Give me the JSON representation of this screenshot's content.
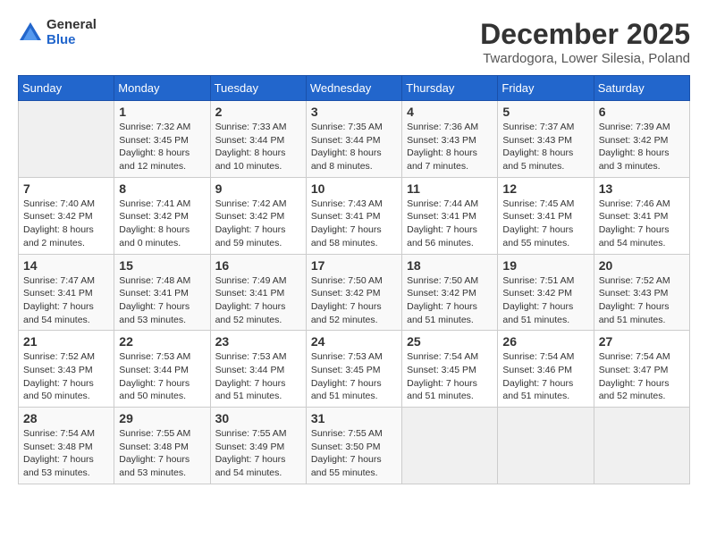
{
  "logo": {
    "general": "General",
    "blue": "Blue"
  },
  "title": "December 2025",
  "location": "Twardogora, Lower Silesia, Poland",
  "days_of_week": [
    "Sunday",
    "Monday",
    "Tuesday",
    "Wednesday",
    "Thursday",
    "Friday",
    "Saturday"
  ],
  "weeks": [
    [
      {
        "day": "",
        "info": ""
      },
      {
        "day": "1",
        "info": "Sunrise: 7:32 AM\nSunset: 3:45 PM\nDaylight: 8 hours\nand 12 minutes."
      },
      {
        "day": "2",
        "info": "Sunrise: 7:33 AM\nSunset: 3:44 PM\nDaylight: 8 hours\nand 10 minutes."
      },
      {
        "day": "3",
        "info": "Sunrise: 7:35 AM\nSunset: 3:44 PM\nDaylight: 8 hours\nand 8 minutes."
      },
      {
        "day": "4",
        "info": "Sunrise: 7:36 AM\nSunset: 3:43 PM\nDaylight: 8 hours\nand 7 minutes."
      },
      {
        "day": "5",
        "info": "Sunrise: 7:37 AM\nSunset: 3:43 PM\nDaylight: 8 hours\nand 5 minutes."
      },
      {
        "day": "6",
        "info": "Sunrise: 7:39 AM\nSunset: 3:42 PM\nDaylight: 8 hours\nand 3 minutes."
      }
    ],
    [
      {
        "day": "7",
        "info": "Sunrise: 7:40 AM\nSunset: 3:42 PM\nDaylight: 8 hours\nand 2 minutes."
      },
      {
        "day": "8",
        "info": "Sunrise: 7:41 AM\nSunset: 3:42 PM\nDaylight: 8 hours\nand 0 minutes."
      },
      {
        "day": "9",
        "info": "Sunrise: 7:42 AM\nSunset: 3:42 PM\nDaylight: 7 hours\nand 59 minutes."
      },
      {
        "day": "10",
        "info": "Sunrise: 7:43 AM\nSunset: 3:41 PM\nDaylight: 7 hours\nand 58 minutes."
      },
      {
        "day": "11",
        "info": "Sunrise: 7:44 AM\nSunset: 3:41 PM\nDaylight: 7 hours\nand 56 minutes."
      },
      {
        "day": "12",
        "info": "Sunrise: 7:45 AM\nSunset: 3:41 PM\nDaylight: 7 hours\nand 55 minutes."
      },
      {
        "day": "13",
        "info": "Sunrise: 7:46 AM\nSunset: 3:41 PM\nDaylight: 7 hours\nand 54 minutes."
      }
    ],
    [
      {
        "day": "14",
        "info": "Sunrise: 7:47 AM\nSunset: 3:41 PM\nDaylight: 7 hours\nand 54 minutes."
      },
      {
        "day": "15",
        "info": "Sunrise: 7:48 AM\nSunset: 3:41 PM\nDaylight: 7 hours\nand 53 minutes."
      },
      {
        "day": "16",
        "info": "Sunrise: 7:49 AM\nSunset: 3:41 PM\nDaylight: 7 hours\nand 52 minutes."
      },
      {
        "day": "17",
        "info": "Sunrise: 7:50 AM\nSunset: 3:42 PM\nDaylight: 7 hours\nand 52 minutes."
      },
      {
        "day": "18",
        "info": "Sunrise: 7:50 AM\nSunset: 3:42 PM\nDaylight: 7 hours\nand 51 minutes."
      },
      {
        "day": "19",
        "info": "Sunrise: 7:51 AM\nSunset: 3:42 PM\nDaylight: 7 hours\nand 51 minutes."
      },
      {
        "day": "20",
        "info": "Sunrise: 7:52 AM\nSunset: 3:43 PM\nDaylight: 7 hours\nand 51 minutes."
      }
    ],
    [
      {
        "day": "21",
        "info": "Sunrise: 7:52 AM\nSunset: 3:43 PM\nDaylight: 7 hours\nand 50 minutes."
      },
      {
        "day": "22",
        "info": "Sunrise: 7:53 AM\nSunset: 3:44 PM\nDaylight: 7 hours\nand 50 minutes."
      },
      {
        "day": "23",
        "info": "Sunrise: 7:53 AM\nSunset: 3:44 PM\nDaylight: 7 hours\nand 51 minutes."
      },
      {
        "day": "24",
        "info": "Sunrise: 7:53 AM\nSunset: 3:45 PM\nDaylight: 7 hours\nand 51 minutes."
      },
      {
        "day": "25",
        "info": "Sunrise: 7:54 AM\nSunset: 3:45 PM\nDaylight: 7 hours\nand 51 minutes."
      },
      {
        "day": "26",
        "info": "Sunrise: 7:54 AM\nSunset: 3:46 PM\nDaylight: 7 hours\nand 51 minutes."
      },
      {
        "day": "27",
        "info": "Sunrise: 7:54 AM\nSunset: 3:47 PM\nDaylight: 7 hours\nand 52 minutes."
      }
    ],
    [
      {
        "day": "28",
        "info": "Sunrise: 7:54 AM\nSunset: 3:48 PM\nDaylight: 7 hours\nand 53 minutes."
      },
      {
        "day": "29",
        "info": "Sunrise: 7:55 AM\nSunset: 3:48 PM\nDaylight: 7 hours\nand 53 minutes."
      },
      {
        "day": "30",
        "info": "Sunrise: 7:55 AM\nSunset: 3:49 PM\nDaylight: 7 hours\nand 54 minutes."
      },
      {
        "day": "31",
        "info": "Sunrise: 7:55 AM\nSunset: 3:50 PM\nDaylight: 7 hours\nand 55 minutes."
      },
      {
        "day": "",
        "info": ""
      },
      {
        "day": "",
        "info": ""
      },
      {
        "day": "",
        "info": ""
      }
    ]
  ]
}
